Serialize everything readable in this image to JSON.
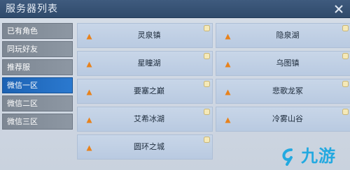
{
  "window": {
    "title": "服务器列表",
    "close_icon": "close-icon"
  },
  "sidebar": {
    "items": [
      {
        "label": "已有角色",
        "active": false
      },
      {
        "label": "同玩好友",
        "active": false
      },
      {
        "label": "推荐服",
        "active": false
      },
      {
        "label": "微信一区",
        "active": true
      },
      {
        "label": "微信二区",
        "active": false
      },
      {
        "label": "微信三区",
        "active": false
      }
    ]
  },
  "servers": [
    {
      "name": "灵泉镇"
    },
    {
      "name": "隐泉湖"
    },
    {
      "name": "星瞳湖"
    },
    {
      "name": "乌图镇"
    },
    {
      "name": "要塞之巅"
    },
    {
      "name": "悲歌龙冢"
    },
    {
      "name": "艾希冰湖"
    },
    {
      "name": "冷雾山谷"
    },
    {
      "name": "圆环之城"
    }
  ],
  "watermark": {
    "text": "九游",
    "icon": "nine-game-logo-icon"
  },
  "colors": {
    "status_orange": "#e8821c",
    "tag_yellow": "#f5e9b8",
    "accent_blue": "#1c62b3"
  }
}
